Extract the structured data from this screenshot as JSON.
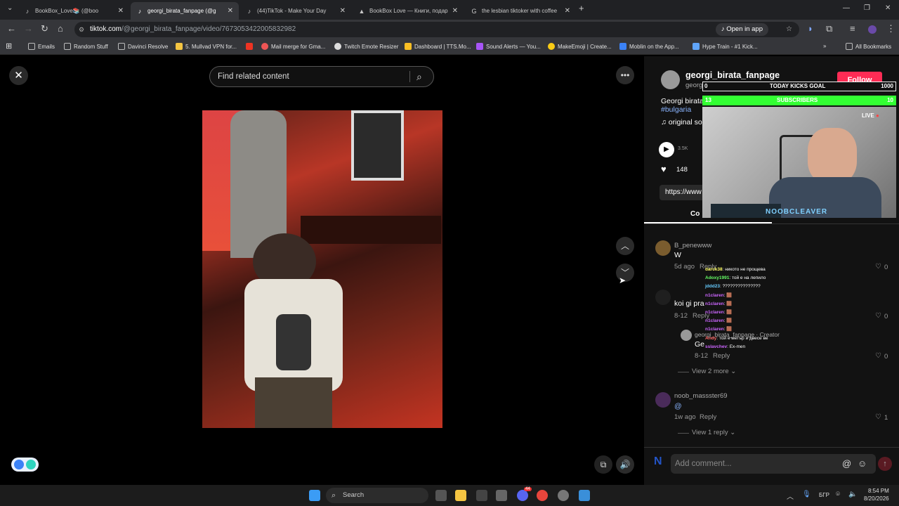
{
  "tabs": [
    {
      "label": "BookBox_Love📚 (@boo",
      "active": false
    },
    {
      "label": "georgi_birata_fanpage (@g",
      "active": true
    },
    {
      "label": "(44)TikTok - Make Your Day",
      "active": false
    },
    {
      "label": "BookBox Love — Книги, подар",
      "active": false
    },
    {
      "label": "the lesbian tiktoker with coffee",
      "active": false
    }
  ],
  "address": {
    "domain": "tiktok.com",
    "path": "/@georgi_birata_fanpage/video/7673053422005832982",
    "open_in_app": "Open in app"
  },
  "bookmarks": [
    {
      "label": "Emails",
      "color": "#888"
    },
    {
      "label": "Random Stuff",
      "color": "#888"
    },
    {
      "label": "Davinci Resolve",
      "color": "#888"
    },
    {
      "label": "5. Mullvad VPN for...",
      "color": "#f5c542"
    },
    {
      "label": "",
      "color": "#e32"
    },
    {
      "label": "Mail merge for Gma...",
      "color": "#e55"
    },
    {
      "label": "Twitch Emote Resizer",
      "color": "#ddd"
    },
    {
      "label": "Dashboard | TTS.Mo...",
      "color": "#fbbf24"
    },
    {
      "label": "Sound Alerts — You...",
      "color": "#a855f7"
    },
    {
      "label": "MakeEmoji | Create...",
      "color": "#facc15"
    },
    {
      "label": "Moblin on the App...",
      "color": "#3b82f6"
    },
    {
      "label": "Hype Train - #1 Kick...",
      "color": "#60a5fa"
    }
  ],
  "all_bookmarks": "All Bookmarks",
  "player": {
    "search_placeholder": "Find related content"
  },
  "post": {
    "username": "georgi_birata_fanpage",
    "handle_date": "georgi_birata_fanpage · 8-12",
    "follow": "Follow",
    "caption": "Georgi birata",
    "hashtag": "#bulgaria",
    "music": "original so",
    "plays": "3.5K",
    "likes": "148",
    "link": "https://www",
    "tab_comments": "Co"
  },
  "comments": [
    {
      "user": "B_penewww",
      "text": "W",
      "time": "5d ago",
      "reply": "Reply",
      "likes": "0"
    },
    {
      "user": "",
      "text": "koi gi pra",
      "time": "8-12",
      "reply": "Reply",
      "likes": "0"
    },
    {
      "user": "georgi_birata_fanpage · Creator",
      "text": "Ge",
      "time": "8-12",
      "reply": "Reply",
      "likes": "0"
    },
    {
      "user": "noob_massster69",
      "text": "@",
      "time": "1w ago",
      "reply": "Reply",
      "likes": "1"
    }
  ],
  "view_more": "View 2 more",
  "view_reply": "View 1 reply",
  "add_comment": "Add comment...",
  "overlay": {
    "goal_label": "TODAY KICKS GOAL",
    "goal_left": "0",
    "goal_right": "1000",
    "subs_left": "13",
    "subs_label": "SUBSCRIBERS",
    "subs_right": "10",
    "live": "LIVE",
    "streamer": "NOOBCLEAVER",
    "chat": [
      {
        "user": "darck38",
        "msg": ": никото не прощева",
        "color": "#ff6"
      },
      {
        "user": "Adoxy1991",
        "msg": ": той е на лепило",
        "color": "#6f6"
      },
      {
        "user": "jddd23",
        "msg": ": ???????????????",
        "color": "#6cf"
      },
      {
        "user": "n1claren",
        "msg": ": 🟫",
        "color": "#c6f"
      },
      {
        "user": "n1claren",
        "msg": ": 🟫",
        "color": "#c6f"
      },
      {
        "user": "n1claren",
        "msg": ": 🟫",
        "color": "#c6f"
      },
      {
        "user": "n1claren",
        "msg": ": 🟫",
        "color": "#c6f"
      },
      {
        "user": "n1claren",
        "msg": ": 🟫",
        "color": "#c6f"
      },
      {
        "user": "Andy",
        "msg": ": той е метър и двесе ве",
        "color": "#f66"
      },
      {
        "user": "sslavchev",
        "msg": ": Ex-men",
        "color": "#c6f"
      }
    ]
  },
  "taskbar": {
    "search": "Search",
    "time": "8:54 PM",
    "date": "8/20/2026",
    "lang": "БГР",
    "notif": "44"
  }
}
